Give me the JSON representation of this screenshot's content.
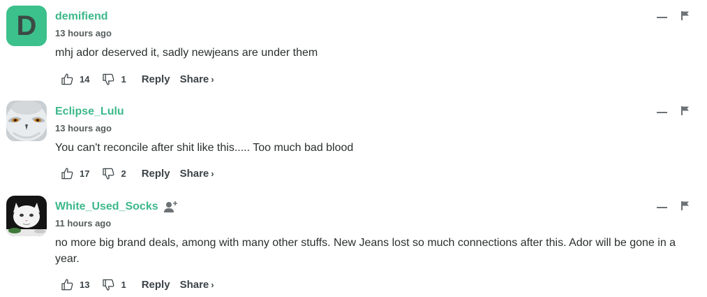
{
  "comments": [
    {
      "author": "demifiend",
      "avatar_letter": "D",
      "avatar_color": "#3cc08c",
      "time": "13 hours ago",
      "text": "mhj ador deserved it, sadly newjeans are under them",
      "upvotes": "14",
      "downvotes": "1",
      "reply_label": "Reply",
      "share_label": "Share",
      "share_chevron": "›"
    },
    {
      "author": "Eclipse_Lulu",
      "avatar_image": "snowy-owl-face",
      "time": "13 hours ago",
      "text": "You can't reconcile after shit like this..... Too much bad blood",
      "upvotes": "17",
      "downvotes": "2",
      "reply_label": "Reply",
      "share_label": "Share",
      "share_chevron": "›"
    },
    {
      "author": "White_Used_Socks",
      "avatar_image": "white-cat-at-table",
      "follow_icon": "follow-user-icon",
      "time": "11 hours ago",
      "text": "no more big brand deals, among with many other stuffs. New Jeans lost so much connections after this. Ador will be gone in a year.",
      "upvotes": "13",
      "downvotes": "1",
      "reply_label": "Reply",
      "share_label": "Share",
      "share_chevron": "›"
    }
  ],
  "colors": {
    "author": "#3cb88a",
    "text": "#2a2e2e",
    "muted": "#555c5c"
  },
  "icons": [
    "thumbs-up-icon",
    "thumbs-down-icon",
    "collapse-icon",
    "flag-icon",
    "follow-user-icon"
  ]
}
